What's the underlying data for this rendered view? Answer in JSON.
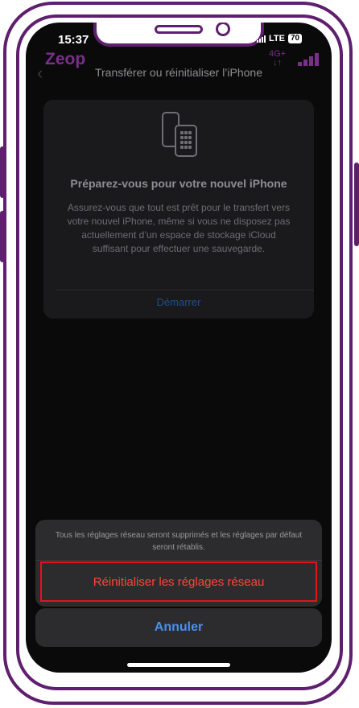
{
  "status": {
    "time": "15:37",
    "network": "LTE",
    "battery": "70"
  },
  "carrier": {
    "name": "Zeop",
    "tech": "4G+",
    "arrows": "↓↑"
  },
  "nav": {
    "title": "Transférer ou réinitialiser l’iPhone"
  },
  "card": {
    "title": "Préparez-vous pour votre nouvel iPhone",
    "body": "Assurez-vous que tout est prêt pour le transfert vers votre nouvel iPhone, même si vous ne disposez pas actuellement d’un espace de stockage iCloud suffisant pour effectuer une sauvegarde.",
    "link": "Démarrer"
  },
  "sheet": {
    "message": "Tous les réglages réseau seront supprimés et les réglages par défaut seront rétablis.",
    "reset_label": "Réinitialiser les réglages réseau",
    "cancel_label": "Annuler"
  },
  "colors": {
    "frame": "#5f1f6e",
    "destructive": "#ff453a",
    "accent": "#4a8ef0",
    "highlight": "#e0141e"
  }
}
